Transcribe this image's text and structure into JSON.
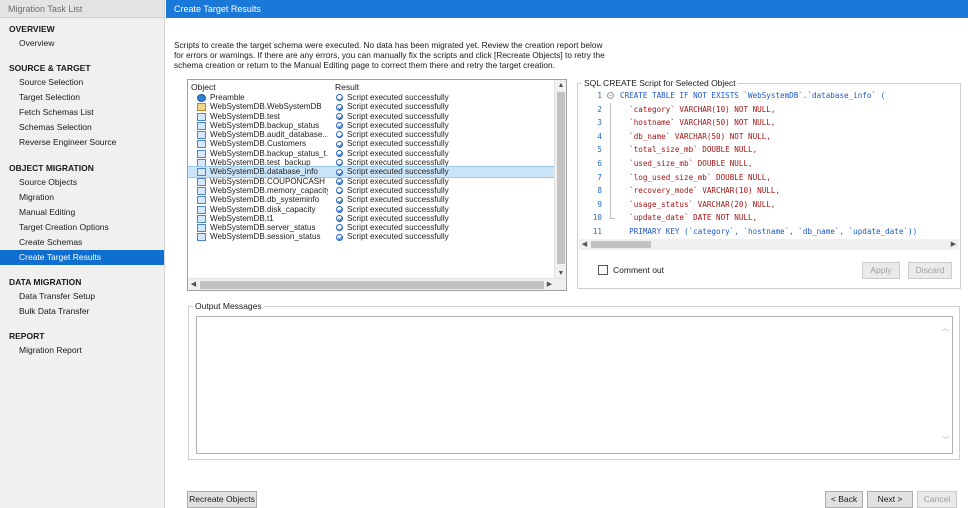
{
  "sidebar": {
    "header": "Migration Task List",
    "sections": [
      {
        "title": "OVERVIEW",
        "items": [
          "Overview"
        ]
      },
      {
        "title": "SOURCE & TARGET",
        "items": [
          "Source Selection",
          "Target Selection",
          "Fetch Schemas List",
          "Schemas Selection",
          "Reverse Engineer Source"
        ]
      },
      {
        "title": "OBJECT MIGRATION",
        "items": [
          "Source Objects",
          "Migration",
          "Manual Editing",
          "Target Creation Options",
          "Create Schemas",
          "Create Target Results"
        ]
      },
      {
        "title": "DATA MIGRATION",
        "items": [
          "Data Transfer Setup",
          "Bulk Data Transfer"
        ]
      },
      {
        "title": "REPORT",
        "items": [
          "Migration Report"
        ]
      }
    ],
    "active_item": "Create Target Results"
  },
  "main": {
    "title": "Create Target Results",
    "intro": "Scripts to create the target schema were executed. No data has been migrated yet. Review the creation report below for errors or warnings. If there are any errors, you can manually fix the scripts and click [Recreate Objects] to retry the schema creation or return to the Manual Editing page to correct them there and retry the target creation.",
    "results": {
      "col_object": "Object",
      "col_result": "Result",
      "rows": [
        {
          "object": "Preamble",
          "result": "Script executed successfully",
          "kind": "info"
        },
        {
          "object": "WebSystemDB.WebSystemDB",
          "result": "Script executed successfully",
          "kind": "schema"
        },
        {
          "object": "WebSystemDB.test",
          "result": "Script executed successfully",
          "kind": "table"
        },
        {
          "object": "WebSystemDB.backup_status",
          "result": "Script executed successfully",
          "kind": "table"
        },
        {
          "object": "WebSystemDB.audit_database...",
          "result": "Script executed successfully",
          "kind": "table"
        },
        {
          "object": "WebSystemDB.Customers",
          "result": "Script executed successfully",
          "kind": "table"
        },
        {
          "object": "WebSystemDB.backup_status_t...",
          "result": "Script executed successfully",
          "kind": "table"
        },
        {
          "object": "WebSystemDB.test_backup",
          "result": "Script executed successfully",
          "kind": "table"
        },
        {
          "object": "WebSystemDB.database_info",
          "result": "Script executed successfully",
          "kind": "table",
          "selected": true
        },
        {
          "object": "WebSystemDB.COUPONCASH",
          "result": "Script executed successfully",
          "kind": "table"
        },
        {
          "object": "WebSystemDB.memory_capacity",
          "result": "Script executed successfully",
          "kind": "table"
        },
        {
          "object": "WebSystemDB.db_systeminfo",
          "result": "Script executed successfully",
          "kind": "table"
        },
        {
          "object": "WebSystemDB.disk_capacity",
          "result": "Script executed successfully",
          "kind": "table"
        },
        {
          "object": "WebSystemDB.t1",
          "result": "Script executed successfully",
          "kind": "table"
        },
        {
          "object": "WebSystemDB.server_status",
          "result": "Script executed successfully",
          "kind": "table"
        },
        {
          "object": "WebSystemDB.session_status",
          "result": "Script executed successfully",
          "kind": "table"
        }
      ]
    },
    "sql": {
      "legend": "SQL CREATE Script for Selected Object",
      "lines": [
        {
          "n": "1",
          "text": "CREATE TABLE IF NOT EXISTS `WebSystemDB`.`database_info` ("
        },
        {
          "n": "2",
          "text": "  `category` VARCHAR(10) NOT NULL,"
        },
        {
          "n": "3",
          "text": "  `hostname` VARCHAR(50) NOT NULL,"
        },
        {
          "n": "4",
          "text": "  `db_name` VARCHAR(50) NOT NULL,"
        },
        {
          "n": "5",
          "text": "  `total_size_mb` DOUBLE NULL,"
        },
        {
          "n": "6",
          "text": "  `used_size_mb` DOUBLE NULL,"
        },
        {
          "n": "7",
          "text": "  `log_used_size_mb` DOUBLE NULL,"
        },
        {
          "n": "8",
          "text": "  `recovery_mode` VARCHAR(10) NULL,"
        },
        {
          "n": "9",
          "text": "  `usage_status` VARCHAR(20) NULL,"
        },
        {
          "n": "10",
          "text": "  `update_date` DATE NOT NULL,"
        },
        {
          "n": "11",
          "text": "  PRIMARY KEY (`category`, `hostname`, `db_name`, `update_date`))"
        }
      ],
      "comment_out_label": "Comment out",
      "apply_label": "Apply",
      "discard_label": "Discard"
    },
    "output": {
      "legend": "Output Messages"
    },
    "buttons": {
      "recreate": "Recreate Objects",
      "back": "< Back",
      "next": "Next >",
      "cancel": "Cancel"
    }
  },
  "colors": {
    "title_bar": "#1a78d9",
    "active_item": "#0f6fd1",
    "selected_row": "#cce4f7"
  }
}
